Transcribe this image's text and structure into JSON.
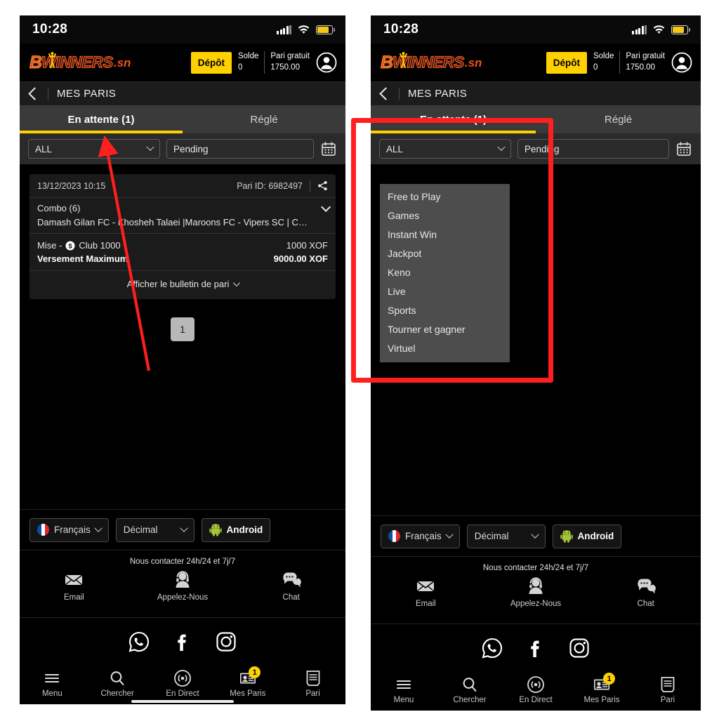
{
  "status_bar": {
    "time": "10:28",
    "signal_icon": "signal-bars-icon",
    "wifi_icon": "wifi-icon",
    "battery_icon": "battery-icon"
  },
  "header": {
    "logo_b": "B",
    "logo_winners": "WINNERS",
    "logo_tld": ".sn",
    "deposit_label": "Dépôt",
    "balance_label": "Solde",
    "balance_value": "0",
    "freebet_label": "Pari gratuit",
    "freebet_value": "1750.00",
    "account_icon": "account-avatar-icon"
  },
  "page": {
    "back_icon": "back-chevron-icon",
    "title": "MES PARIS"
  },
  "tabs": [
    {
      "label": "En attente (1)",
      "active": true
    },
    {
      "label": "Réglé",
      "active": false
    }
  ],
  "filters": {
    "category_select_value": "ALL",
    "status_field_value": "Pending",
    "calendar_icon": "calendar-icon",
    "dropdown_open": true,
    "dropdown_options": [
      "Free to Play",
      "Games",
      "Instant Win",
      "Jackpot",
      "Keno",
      "Live",
      "Sports",
      "Tourner et gagner",
      "Virtuel"
    ]
  },
  "bet_card": {
    "date": "13/12/2023 10:15",
    "bet_id": "Pari ID: 6982497",
    "share_icon": "share-icon",
    "combo_label": "Combo (6)",
    "expand_icon": "chevron-down-icon",
    "teams": "Damash Gilan FC - Khosheh Talaei |Maroons FC - Vipers SC | C…",
    "stake_label": "Mise -",
    "stake_club": "Club 1000",
    "stake_coin_icon": "coin-icon",
    "stake_value": "1000 XOF",
    "max_payout_label": "Versement Maximum",
    "max_payout_value": "9000.00 XOF",
    "show_slip_label": "Afficher le bulletin de pari"
  },
  "pagination": {
    "current_page": "1"
  },
  "preferences": {
    "language": "Français",
    "language_flag_icon": "france-flag-icon",
    "odds_format": "Décimal",
    "app_label": "Android",
    "app_icon": "android-icon"
  },
  "contact": {
    "title": "Nous contacter 24h/24 et 7j/7",
    "items": [
      {
        "label": "Email",
        "icon": "envelope-icon"
      },
      {
        "label": "Appelez-Nous",
        "icon": "headset-agent-icon"
      },
      {
        "label": "Chat",
        "icon": "chat-bubbles-icon"
      }
    ]
  },
  "social": [
    {
      "icon": "whatsapp-icon"
    },
    {
      "icon": "facebook-icon"
    },
    {
      "icon": "instagram-icon"
    }
  ],
  "bottom_nav": [
    {
      "label": "Menu",
      "icon": "hamburger-menu-icon",
      "badge": ""
    },
    {
      "label": "Chercher",
      "icon": "search-icon",
      "badge": ""
    },
    {
      "label": "En Direct",
      "icon": "live-broadcast-icon",
      "badge": ""
    },
    {
      "label": "Mes Paris",
      "icon": "my-bets-icon",
      "badge": "1"
    },
    {
      "label": "Pari",
      "icon": "betslip-icon",
      "badge": ""
    }
  ],
  "annotations": {
    "arrow_color": "#ff1f1f",
    "highlight_color": "#ff1f1f"
  }
}
